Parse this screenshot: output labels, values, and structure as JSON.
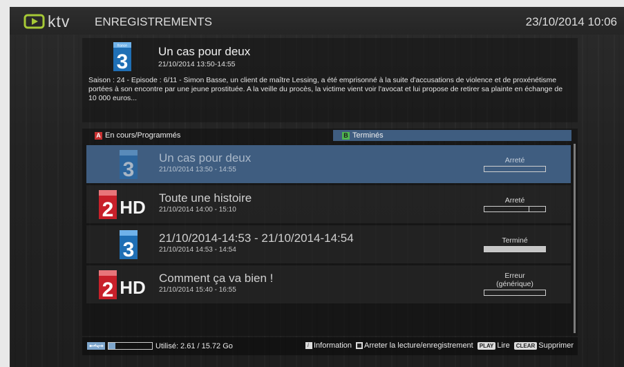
{
  "header": {
    "logo_text": "ktv",
    "title": "ENREGISTREMENTS",
    "datetime": "23/10/2014 10:06"
  },
  "detail": {
    "channel_icon": "france3-logo",
    "title": "Un cas pour deux",
    "time": "21/10/2014 13:50-14:55",
    "description": "Saison : 24 - Episode : 6/11 - Simon Basse, un client de maître Lessing, a été emprisonné à la suite d'accusations de violence et de proxénétisme portées à son encontre par une jeune prostituée. A la veille du procès, la victime vient voir l'avocat et lui propose de retirer sa plainte en échange de 10 000 euros..."
  },
  "tabs": [
    {
      "key": "A",
      "label": "En cours/Programmés",
      "active": false,
      "key_color": "#c83232"
    },
    {
      "key": "B",
      "label": "Terminés",
      "active": true,
      "key_color": "#4fb64f"
    }
  ],
  "recordings": [
    {
      "channel_icon": "france3-logo",
      "title": "Un cas pour deux",
      "time": "21/10/2014 13:50 - 14:55",
      "status": "Arreté",
      "progress": 0.0,
      "selected": true
    },
    {
      "channel_icon": "france2hd-logo",
      "title": "Toute une histoire",
      "time": "21/10/2014 14:00 - 15:10",
      "status": "Arreté",
      "progress": 0.73,
      "selected": false
    },
    {
      "channel_icon": "france3-logo",
      "title": "21/10/2014-14:53 - 21/10/2014-14:54",
      "time": "21/10/2014 14:53 - 14:54",
      "status": "Terminé",
      "progress": 1.0,
      "selected": false
    },
    {
      "channel_icon": "france2hd-logo",
      "title": "Comment ça va bien !",
      "time": "21/10/2014 15:40 - 16:55",
      "status": "Erreur\n(générique)",
      "progress": 0.0,
      "selected": false
    }
  ],
  "footer": {
    "usb_icon": "usb-icon",
    "usage_fraction": 0.166,
    "usage_text": "Utilisé: 2.61 / 15.72 Go",
    "info_key": "i",
    "info_label": "Information",
    "stop_label": "Arreter la lecture/enregistrement",
    "play_key": "PLAY",
    "play_label": "Lire",
    "clear_key": "CLEAR",
    "clear_label": "Supprimer"
  },
  "colors": {
    "selection": "#3f5d80",
    "accent_blue": "#7ea6cc",
    "france3_blue": "#1f6fb5",
    "france2_red": "#c8202a"
  }
}
